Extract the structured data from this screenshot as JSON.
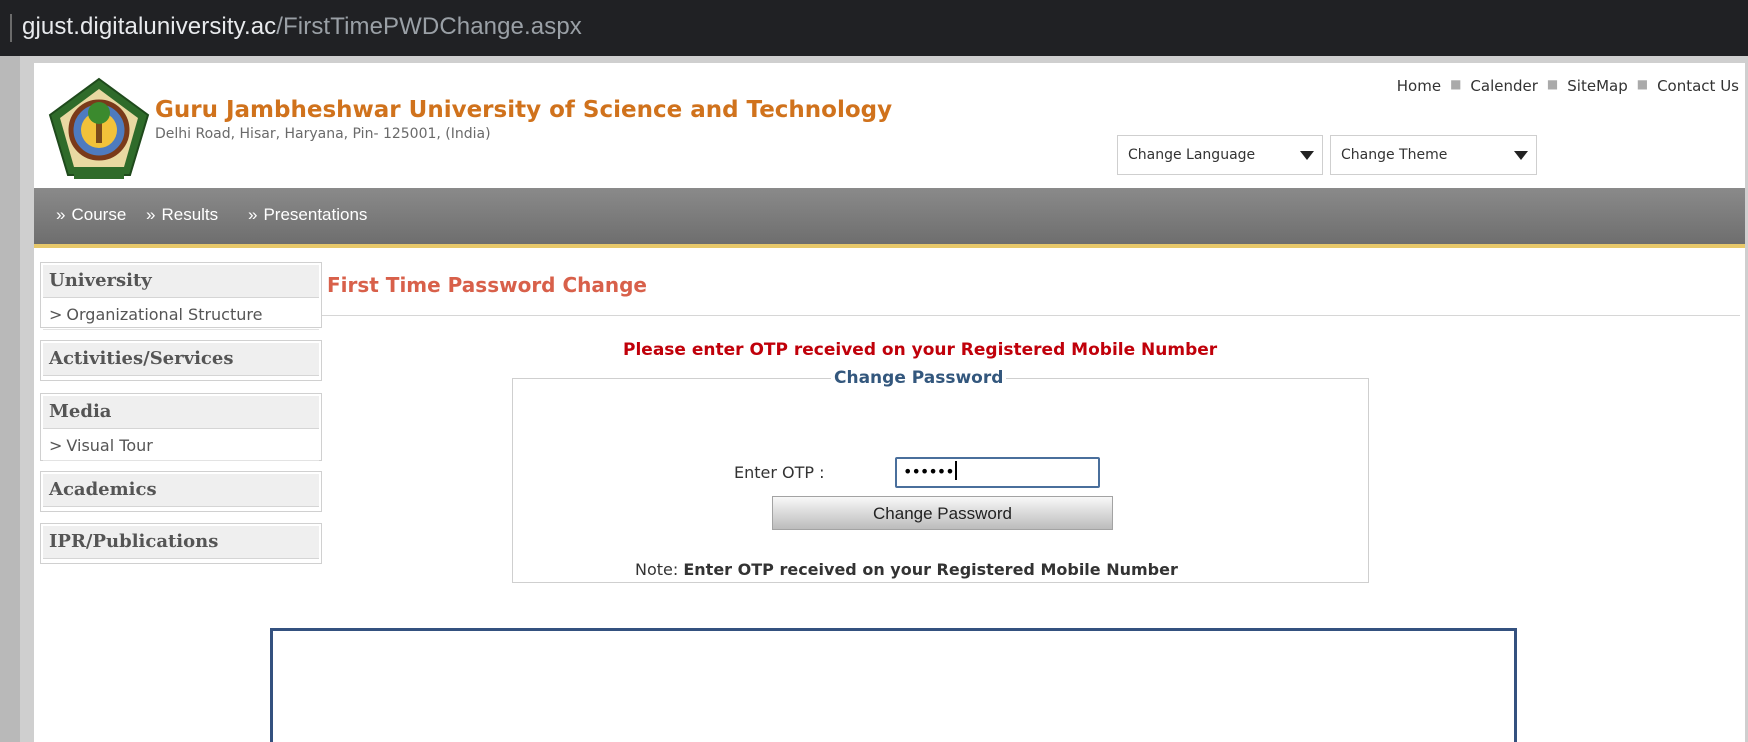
{
  "browser": {
    "url_host": "gjust.digitaluniversity.ac",
    "url_path": "/FirstTimePWDChange.aspx"
  },
  "header": {
    "university_name": "Guru Jambheshwar University of Science and Technology",
    "address": "Delhi Road, Hisar, Haryana, Pin- 125001, (India)",
    "top_links": [
      "Home",
      "Calender",
      "SiteMap",
      "Contact Us"
    ],
    "language_select": "Change Language",
    "theme_select": "Change Theme"
  },
  "nav": {
    "items": [
      "Course",
      "Results",
      "Presentations"
    ],
    "marker": "»"
  },
  "sidebar": {
    "sections": [
      {
        "title": "University",
        "items": [
          "Organizational Structure"
        ]
      },
      {
        "title": "Activities/Services",
        "items": []
      },
      {
        "title": "Media",
        "items": [
          "Visual Tour"
        ]
      },
      {
        "title": "Academics",
        "items": []
      },
      {
        "title": "IPR/Publications",
        "items": []
      }
    ],
    "item_marker": ">"
  },
  "main": {
    "page_title": "First Time Password Change",
    "notice": "Please enter OTP received on your Registered Mobile Number",
    "fieldset_legend": "Change Password",
    "otp_label": "Enter OTP :",
    "otp_value": "••••••",
    "submit_label": "Change Password",
    "note_prefix": "Note:",
    "note_text": "Enter OTP received on your Registered Mobile Number"
  },
  "colors": {
    "university_name": "#d0721c",
    "page_title": "#d8604a",
    "notice": "#c0000a",
    "legend": "#33577d",
    "nav_bar": "#7a7a7a",
    "nav_underline": "#e7c86a",
    "overlay_border": "#34517f"
  }
}
